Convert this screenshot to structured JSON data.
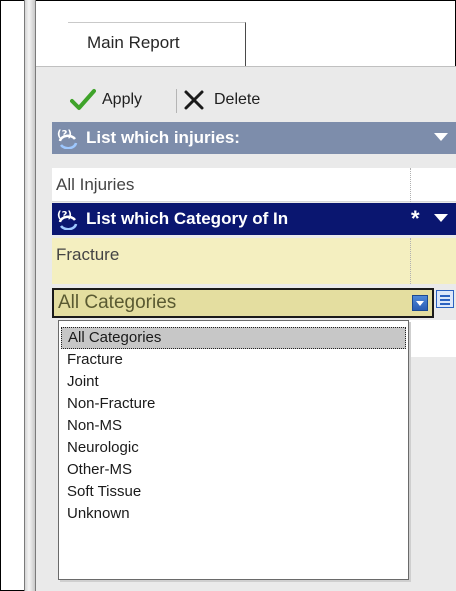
{
  "tab": {
    "label": "Main Report"
  },
  "toolbar": {
    "apply_label": "Apply",
    "delete_label": "Delete"
  },
  "filters": [
    {
      "title": "List which injuries:",
      "value": "All Injuries"
    },
    {
      "title": "List which Category of In",
      "required_mark": "*",
      "value": "Fracture"
    }
  ],
  "combo": {
    "selected": "All Categories"
  },
  "dropdown": {
    "options": [
      "All Categories",
      "Fracture",
      "Joint",
      "Non-Fracture",
      "Non-MS",
      "Neurologic",
      "Other-MS",
      "Soft Tissue",
      "Unknown"
    ]
  },
  "colors": {
    "header1": "#7d8dab",
    "header2": "#0a1670",
    "fracture_bg": "#f4efc0",
    "combo_bg": "#e4dea0",
    "apply_check": "#3fa32a"
  },
  "icons": {
    "apply": "checkmark-icon",
    "delete": "x-icon",
    "parameter": "question-refresh-icon",
    "expand": "chevron-down-icon",
    "combo": "dropdown-arrow-icon",
    "list": "list-view-icon"
  }
}
